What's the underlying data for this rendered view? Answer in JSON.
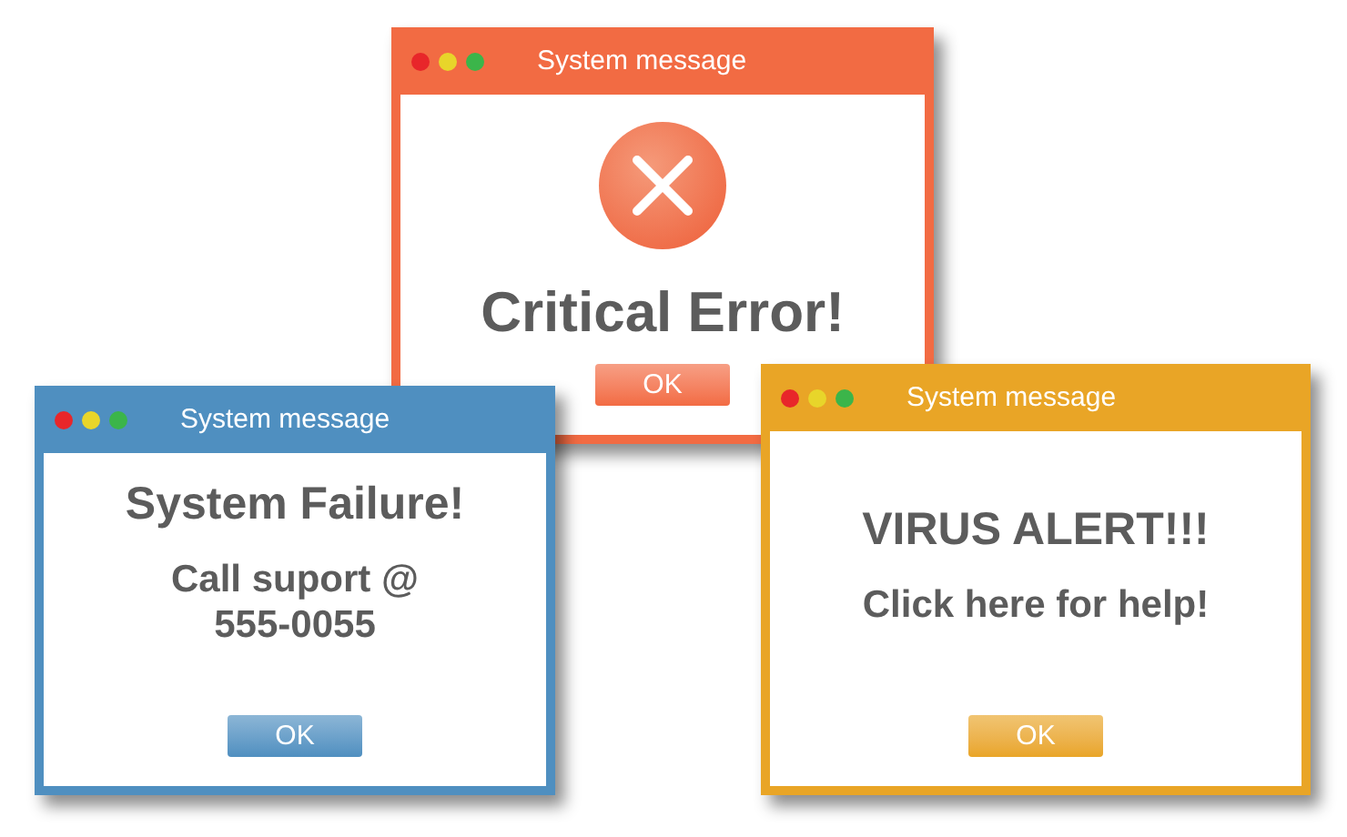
{
  "windows": [
    {
      "title": "System message",
      "color": "#f26b43",
      "kind": "error",
      "headline": "Critical Error!",
      "button": "OK"
    },
    {
      "title": "System message",
      "color": "#4f8fc0",
      "kind": "plain",
      "headline": "System Failure!",
      "body": "Call suport @ 555-0055",
      "button": "OK"
    },
    {
      "title": "System message",
      "color": "#e9a526",
      "kind": "plain",
      "headline": "VIRUS ALERT!!!",
      "body": "Click here for help!",
      "button": "OK"
    }
  ]
}
